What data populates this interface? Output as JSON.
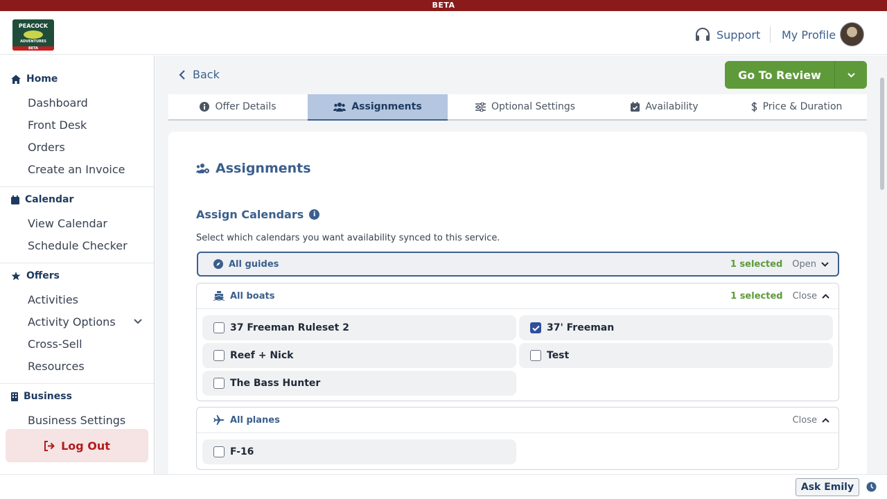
{
  "beta_label": "BETA",
  "logo": {
    "line1": "PEACOCK",
    "line2": "ADVENTURES",
    "line3": "BETA"
  },
  "header": {
    "support": "Support",
    "profile": "My Profile"
  },
  "sidebar": {
    "home": {
      "title": "Home",
      "items": [
        "Dashboard",
        "Front Desk",
        "Orders",
        "Create an Invoice"
      ]
    },
    "calendar": {
      "title": "Calendar",
      "items": [
        "View Calendar",
        "Schedule Checker"
      ]
    },
    "offers": {
      "title": "Offers",
      "items": [
        "Activities",
        "Activity Options",
        "Cross-Sell",
        "Resources"
      ]
    },
    "business": {
      "title": "Business",
      "items": [
        "Business Settings"
      ]
    },
    "logout": "Log Out"
  },
  "topbar": {
    "back": "Back",
    "review": "Go To Review"
  },
  "tabs": [
    {
      "label": "Offer Details",
      "active": false
    },
    {
      "label": "Assignments",
      "active": true
    },
    {
      "label": "Optional Settings",
      "active": false
    },
    {
      "label": "Availability",
      "active": false
    },
    {
      "label": "Price & Duration",
      "active": false
    }
  ],
  "card": {
    "title": "Assignments",
    "subtitle": "Assign Calendars",
    "info_glyph": "i",
    "description": "Select which calendars you want availability synced to this service."
  },
  "groups": {
    "guides": {
      "name": "All guides",
      "count": "1 selected",
      "toggle": "Open"
    },
    "boats": {
      "name": "All boats",
      "count": "1 selected",
      "toggle": "Close",
      "options": [
        {
          "label": "37 Freeman Ruleset 2",
          "checked": false
        },
        {
          "label": "37' Freeman",
          "checked": true
        },
        {
          "label": "Reef + Nick",
          "checked": false
        },
        {
          "label": "Test",
          "checked": false
        },
        {
          "label": "The Bass Hunter",
          "checked": false
        }
      ]
    },
    "planes": {
      "name": "All planes",
      "toggle": "Close",
      "options": [
        {
          "label": "F-16",
          "checked": false
        }
      ]
    }
  },
  "footer": {
    "ask": "Ask Emily"
  },
  "colors": {
    "accent": "#3b5f8c",
    "success": "#5e9a3a",
    "danger": "#b31b1b",
    "beta": "#8b1a1a"
  }
}
